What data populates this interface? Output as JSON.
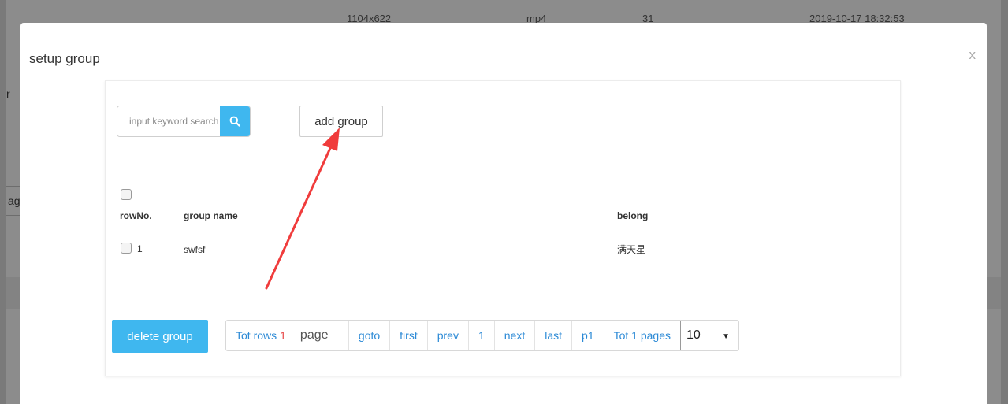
{
  "background": {
    "row": {
      "resolution": "1104x622",
      "format": "mp4",
      "count": "31",
      "date": "2019-10-17 18:32:53"
    },
    "fragment_r": "r",
    "fragment_box": "ag"
  },
  "modal": {
    "title": "setup group",
    "close_glyph": "x"
  },
  "search": {
    "placeholder": "input keyword search"
  },
  "add_group_label": "add group",
  "table": {
    "headers": {
      "rowno": "rowNo.",
      "name": "group name",
      "belong": "belong"
    },
    "rows": [
      {
        "no": "1",
        "name": "swfsf",
        "belong": "满天星"
      }
    ]
  },
  "delete_group_label": "delete group",
  "pager": {
    "tot_rows_label": "Tot rows",
    "tot_rows_value": "1",
    "page_placeholder": "page",
    "goto": "goto",
    "first": "first",
    "prev": "prev",
    "current": "1",
    "next": "next",
    "last": "last",
    "p1": "p1",
    "tot_pages": "Tot 1 pages",
    "page_size": "10"
  },
  "colors": {
    "accent": "#3fb7ef",
    "link": "#2c8ad6",
    "arrow": "#f03c3c",
    "count": "#e84a4a"
  },
  "icons": {
    "search": "search-icon",
    "caret": "caret-down-icon"
  }
}
